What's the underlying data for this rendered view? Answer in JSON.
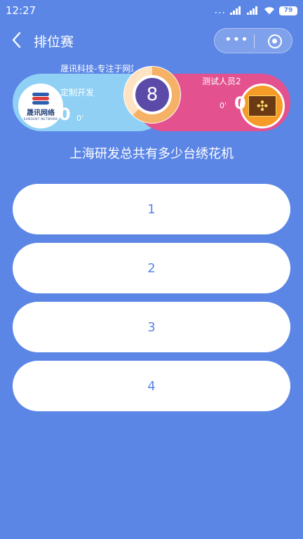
{
  "status_bar": {
    "time": "12:27",
    "dots": "...",
    "battery": "79"
  },
  "nav": {
    "title": "排位赛",
    "capsule_more": "•••"
  },
  "battle": {
    "left": {
      "name": "晟讯科技-专注于网站",
      "subtitle": "定制开发",
      "score": "0",
      "delta": "0'",
      "logo_text": "晟讯网络",
      "logo_en": "SUNGENT NETWORK"
    },
    "right": {
      "name": "测试人员2",
      "score": "0",
      "delta": "0'"
    },
    "timer": {
      "value": "8",
      "progress": 0.62
    }
  },
  "question": "上海研发总共有多少台绣花机",
  "options": [
    "1",
    "2",
    "3",
    "4"
  ],
  "colors": {
    "background": "#5b86e6",
    "left_pill": "#8fd0f4",
    "right_pill": "#e4518f",
    "timer_ring": "#f5b165",
    "timer_center": "#5b4aa8"
  }
}
